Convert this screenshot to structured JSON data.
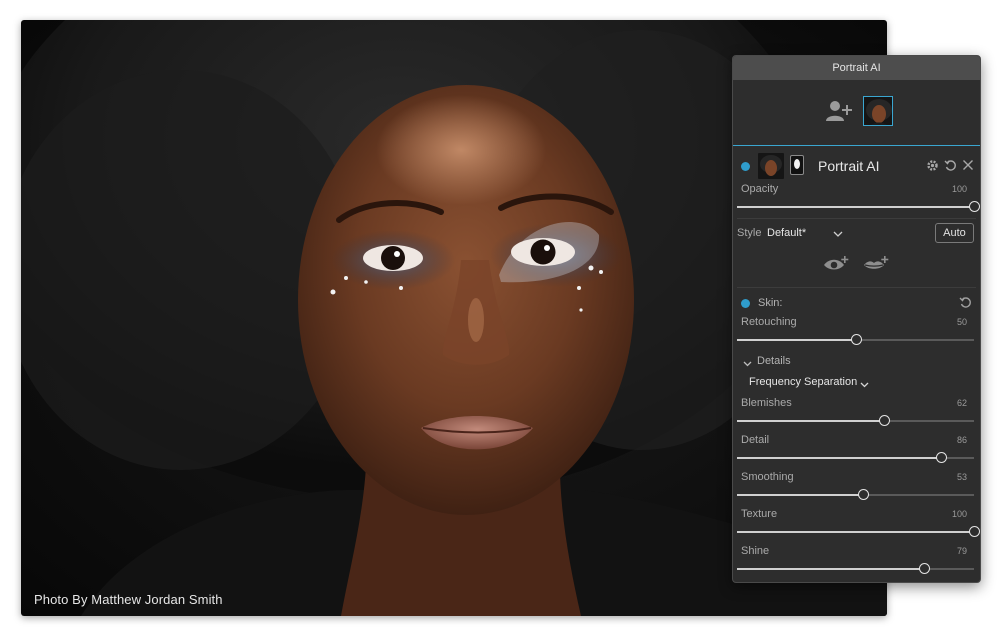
{
  "photo": {
    "credit": "Photo By Matthew Jordan Smith"
  },
  "panel": {
    "title": "Portrait AI",
    "filter_name": "Portrait AI",
    "opacity": {
      "label": "Opacity",
      "value": 100
    },
    "style": {
      "label": "Style",
      "value": "Default*",
      "auto_label": "Auto"
    },
    "skin": {
      "label": "Skin:",
      "retouching": {
        "label": "Retouching",
        "value": 50
      },
      "details_label": "Details",
      "mode": "Frequency Separation",
      "sliders": [
        {
          "label": "Blemishes",
          "value": 62
        },
        {
          "label": "Detail",
          "value": 86
        },
        {
          "label": "Smoothing",
          "value": 53
        },
        {
          "label": "Texture",
          "value": 100
        },
        {
          "label": "Shine",
          "value": 79
        }
      ]
    }
  },
  "colors": {
    "accent": "#2f9ccb",
    "panel_bg": "#2d2d2d",
    "title_bar": "#4d4d4d"
  },
  "icons": [
    "add-person-icon",
    "face-thumbnail",
    "gear-icon",
    "reset-icon",
    "close-icon",
    "chevron-down-icon",
    "eye-plus-icon",
    "lips-plus-icon"
  ]
}
